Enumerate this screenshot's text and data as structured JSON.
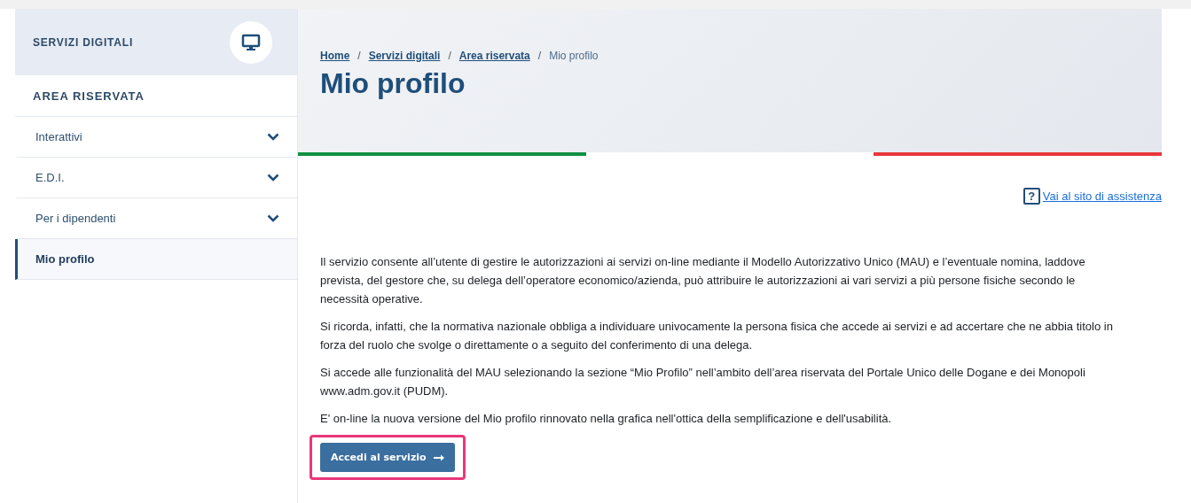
{
  "sidebar": {
    "header": "SERVIZI DIGITALI",
    "section_title": "AREA RISERVATA",
    "items": [
      {
        "label": "Interattivi",
        "kind": "group",
        "selected": false
      },
      {
        "label": "E.D.I.",
        "kind": "group",
        "selected": false
      },
      {
        "label": "Per i dipendenti",
        "kind": "group",
        "selected": false
      },
      {
        "label": "Mio profilo",
        "kind": "link",
        "selected": true
      }
    ]
  },
  "breadcrumb": [
    {
      "label": "Home",
      "current": false
    },
    {
      "label": "Servizi digitali",
      "current": false
    },
    {
      "label": "Area riservata",
      "current": false
    },
    {
      "label": "Mio profilo",
      "current": true
    }
  ],
  "breadcrumb_separator": "/",
  "page_title": "Mio profilo",
  "help_icon": "?",
  "help_link": "Vai al sito di assistenza",
  "paragraphs": [
    "Il servizio consente all’utente di gestire le autorizzazioni ai servizi on-line mediante il Modello Autorizzativo Unico (MAU) e l’eventuale nomina, laddove prevista, del gestore che, su delega dell’operatore economico/azienda, può attribuire le autorizzazioni ai vari servizi a più persone fisiche secondo le necessità operative.",
    "Si ricorda, infatti, che la normativa nazionale obbliga a individuare univocamente la persona fisica che accede ai servizi e ad accertare che ne abbia titolo in forza del ruolo che svolge o direttamente o a seguito del conferimento di una delega.",
    "Si accede alle funzionalità del MAU selezionando la sezione “Mio Profilo” nell’ambito dell’area riservata del Portale Unico delle Dogane e dei Monopoli www.adm.gov.it (PUDM).",
    "E' on-line la nuova versione del Mio profilo rinnovato nella grafica nell'ottica della semplificazione e dell'usabilità."
  ],
  "action_button": {
    "label": "Accedi al servizio",
    "highlighted": true
  }
}
